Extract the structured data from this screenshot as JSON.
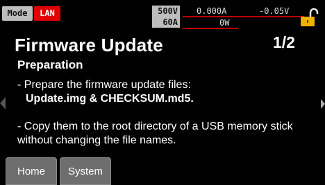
{
  "status": {
    "mode": "Mode",
    "lan": "LAN",
    "spec_voltage": "500V",
    "spec_current": "60A",
    "meas_current": "0.000A",
    "meas_voltage": "-0.05V",
    "meas_power": "0W",
    "lock_icon": "padlock-unlocked-icon",
    "colors": {
      "lan_bg": "#e00000",
      "lock": "#f0b000"
    }
  },
  "content": {
    "title": "Firmware Update",
    "page": "1/2",
    "subtitle": "Preparation",
    "step1": "- Prepare the firmware update files:",
    "files": "Update.img & CHECKSUM.md5.",
    "step2": "- Copy them to the root directory of a USB memory stick without changing the file names."
  },
  "tabs": [
    {
      "label": "Home"
    },
    {
      "label": "System"
    }
  ]
}
